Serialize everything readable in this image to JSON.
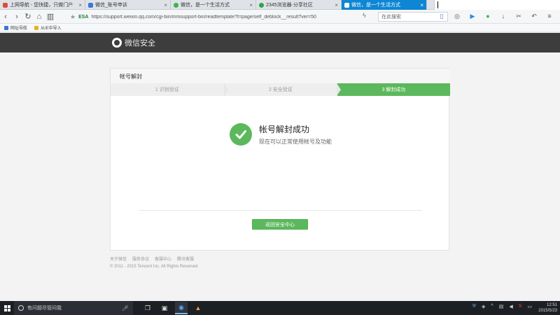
{
  "browser": {
    "tabs": [
      {
        "label": "上网导航 - 您快捷，只做门户",
        "color": "#e04b3a",
        "active": false
      },
      {
        "label": "微信_账号申诉",
        "color": "#3a78d4",
        "active": false
      },
      {
        "label": "微信，是一个生活方式",
        "color": "#3bb54a",
        "active": false
      },
      {
        "label": "2345浏览器·分享社区",
        "color": "#2fa44f",
        "active": false
      },
      {
        "label": "微信，是一个生活方式",
        "color": "#ffffff",
        "active": true
      }
    ],
    "url_badge": "ESA",
    "url": "https://support.weixin.qq.com/cgi-bin/mmsupport-bin/readtemplate?t=page/self_deblock__result?ver=50",
    "search_placeholder": "在此搜索",
    "bookmarks": [
      {
        "label": "网址导航",
        "color": "#3a78d4"
      },
      {
        "label": "从IE中导入",
        "color": "#e6b422"
      }
    ]
  },
  "site": {
    "brand": "微信安全"
  },
  "card": {
    "title": "帐号解封",
    "steps": [
      {
        "label": "1 识别验证",
        "state": "done"
      },
      {
        "label": "2 安全验证",
        "state": "done"
      },
      {
        "label": "3 解封成功",
        "state": "current"
      }
    ],
    "result_title": "帐号解封成功",
    "result_desc": "现在可以正常使用帐号及功能",
    "button": "返回安全中心"
  },
  "footer": {
    "links": [
      "关于微信",
      "服务协议",
      "客服中心",
      "腾讯客服"
    ],
    "copyright": "© 2011 - 2015 Tencent Inc. All Rights Reserved"
  },
  "taskbar": {
    "search_placeholder": "有问题尽管问我",
    "time": "12:51",
    "date": "2015/5/23"
  }
}
